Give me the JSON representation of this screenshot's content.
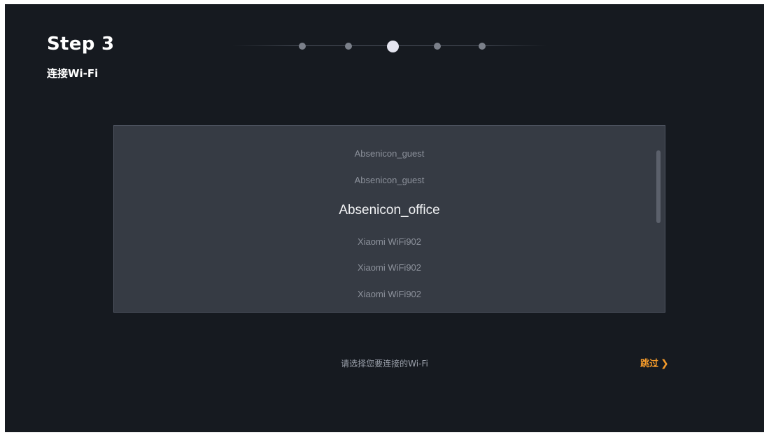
{
  "header": {
    "step_title": "Step 3",
    "step_subtitle": "连接Wi-Fi"
  },
  "progress": {
    "total_steps": 5,
    "current_step": 3
  },
  "wifi_list": {
    "items": [
      "Absenicon_guest",
      "Absenicon_guest",
      "Absenicon_office",
      "Xiaomi WiFi902",
      "Xiaomi WiFi902",
      "Xiaomi WiFi902"
    ],
    "selected_index": 2
  },
  "footer": {
    "hint": "请选择您要连接的Wi-Fi",
    "skip_label": "跳过",
    "skip_icon": "chevron-right-icon"
  },
  "colors": {
    "background": "#161a20",
    "panel": "#363b44",
    "accent": "#f39a2a",
    "active_dot": "#e4e5ef"
  }
}
